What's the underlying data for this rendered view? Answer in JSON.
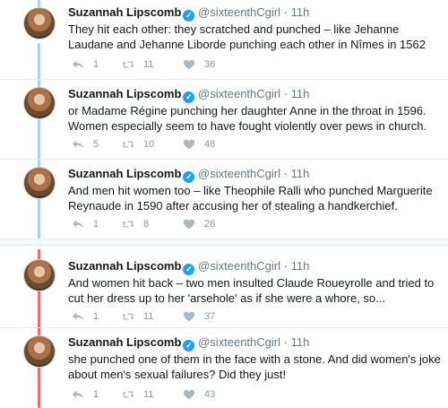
{
  "colors": {
    "thread_blue": "#a8d2f4",
    "thread_red": "#f26a6a",
    "verified": "#1da1f2"
  },
  "tweets": [
    {
      "name": "Suzannah Lipscomb",
      "handle": "@sixteenthCgirl",
      "dot": "·",
      "time": "11h",
      "text": "They hit each other: they scratched and punched – like Jehanne Laudane and Jehanne Liborde punching each other in Nîmes in 1562",
      "replies": "1",
      "retweets": "11",
      "likes": "36"
    },
    {
      "name": "Suzannah Lipscomb",
      "handle": "@sixteenthCgirl",
      "dot": "·",
      "time": "11h",
      "text": "or Madame Régine punching her daughter Anne in the throat in 1596. Women especially seem to have fought violently over pews in church.",
      "replies": "5",
      "retweets": "10",
      "likes": "48"
    },
    {
      "name": "Suzannah Lipscomb",
      "handle": "@sixteenthCgirl",
      "dot": "·",
      "time": "11h",
      "text": "And men hit women too – like Theophile Ralli who punched Marguerite Reynaude in 1590 after accusing her of stealing a handkerchief.",
      "replies": "1",
      "retweets": "8",
      "likes": "26"
    },
    {
      "name": "Suzannah Lipscomb",
      "handle": "@sixteenthCgirl",
      "dot": "·",
      "time": "11h",
      "text": "And women hit back – two men insulted Claude Roueyrolle and tried to cut her dress up to her 'arsehole' as if she were a whore, so...",
      "replies": "1",
      "retweets": "11",
      "likes": "37"
    },
    {
      "name": "Suzannah Lipscomb",
      "handle": "@sixteenthCgirl",
      "dot": "·",
      "time": "11h",
      "text": "she punched one of them in the face with a stone. And did women's joke about men's sexual failures? Did they just!",
      "replies": "1",
      "retweets": "11",
      "likes": "43"
    }
  ]
}
